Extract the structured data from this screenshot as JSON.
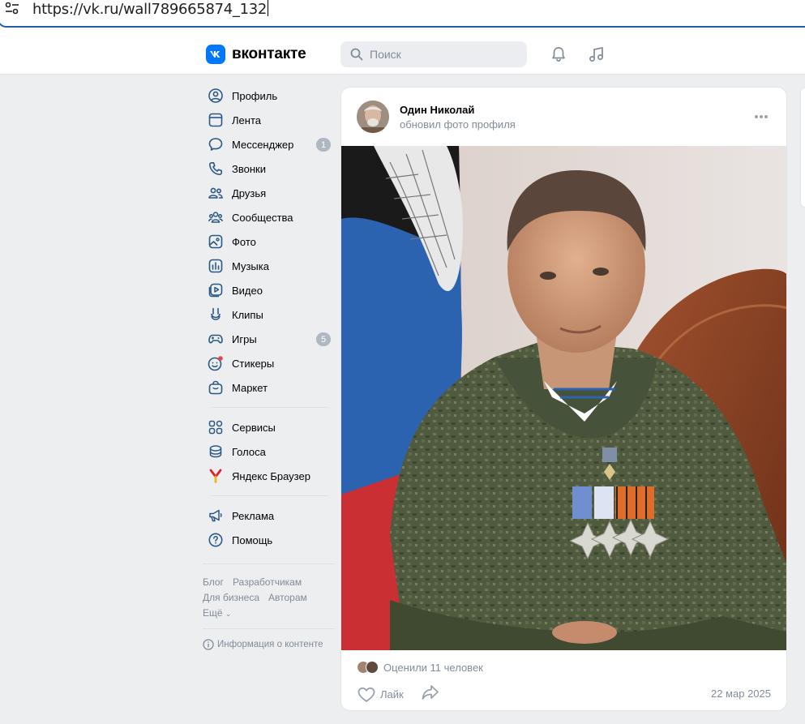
{
  "browser": {
    "url": "https://vk.ru/wall789665874_132"
  },
  "header": {
    "logo_text": "вконтакте",
    "search_placeholder": "Поиск",
    "accent": "#0077ff"
  },
  "nav": {
    "items": [
      {
        "label": "Профиль",
        "icon": "user-circle-icon"
      },
      {
        "label": "Лента",
        "icon": "feed-icon"
      },
      {
        "label": "Мессенджер",
        "icon": "chat-icon",
        "badge": "1"
      },
      {
        "label": "Звонки",
        "icon": "phone-icon"
      },
      {
        "label": "Друзья",
        "icon": "friends-icon"
      },
      {
        "label": "Сообщества",
        "icon": "communities-icon"
      },
      {
        "label": "Фото",
        "icon": "photo-icon"
      },
      {
        "label": "Музыка",
        "icon": "music-icon"
      },
      {
        "label": "Видео",
        "icon": "video-icon"
      },
      {
        "label": "Клипы",
        "icon": "clips-icon"
      },
      {
        "label": "Игры",
        "icon": "games-icon",
        "badge": "5"
      },
      {
        "label": "Стикеры",
        "icon": "stickers-icon"
      },
      {
        "label": "Маркет",
        "icon": "market-icon"
      }
    ],
    "services": [
      {
        "label": "Сервисы",
        "icon": "services-icon"
      },
      {
        "label": "Голоса",
        "icon": "votes-icon"
      },
      {
        "label": "Яндекс Браузер",
        "icon": "yandex-browser-icon"
      }
    ],
    "extra": [
      {
        "label": "Реклама",
        "icon": "ads-icon"
      },
      {
        "label": "Помощь",
        "icon": "help-icon"
      }
    ],
    "footer": {
      "blog": "Блог",
      "developers": "Разработчикам",
      "business": "Для бизнеса",
      "authors": "Авторам",
      "more": "Ещё",
      "content_info": "Информация о контенте"
    }
  },
  "post": {
    "author": "Один Николай",
    "action": "обновил фото профиля",
    "likes_text": "Оценили 11 человек",
    "like_label": "Лайк",
    "date": "22 мар 2025"
  }
}
